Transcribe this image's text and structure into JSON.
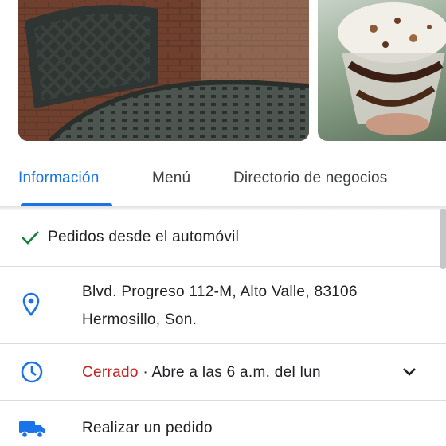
{
  "photos": [
    {
      "icon": "patio-chair-photo"
    },
    {
      "icon": "ice-cream-sundae-photo"
    }
  ],
  "tabs": [
    {
      "label": "Información",
      "active": true
    },
    {
      "label": "Menú",
      "active": false
    },
    {
      "label": "Directorio de negocios",
      "active": false
    }
  ],
  "info": {
    "drive_through": {
      "icon": "check-icon",
      "label": "Pedidos desde el automóvil"
    },
    "address": {
      "icon": "location-pin-icon",
      "line1": "Blvd. Progreso 112-M, Alto Valle, 83106",
      "line2": "Hermosillo, Son."
    },
    "hours": {
      "icon": "clock-icon",
      "status": "Cerrado",
      "detail": " · Abre a las 6 a.m. del lun",
      "expand_icon": "chevron-down-icon"
    },
    "order": {
      "icon": "delivery-truck-icon",
      "label": "Realizar un pedido"
    }
  },
  "colors": {
    "accent": "#1a73e8",
    "closed": "#c5221f",
    "check": "#188038"
  }
}
